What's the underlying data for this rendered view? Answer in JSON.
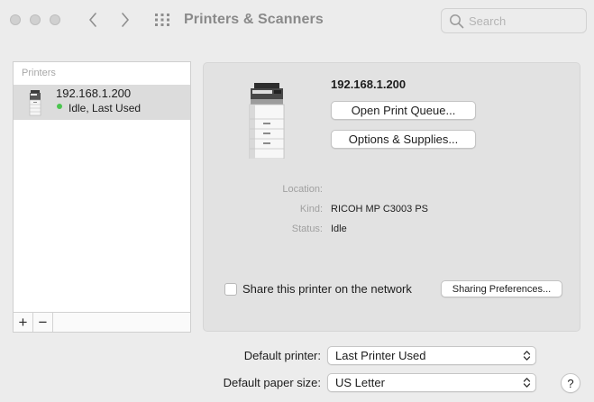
{
  "window": {
    "title": "Printers & Scanners"
  },
  "toolbar": {
    "back_icon": "chevron-left-icon",
    "forward_icon": "chevron-right-icon",
    "show_all_icon": "grid-icon"
  },
  "search": {
    "placeholder": "Search",
    "value": ""
  },
  "printer_list": {
    "header": "Printers",
    "items": [
      {
        "name": "192.168.1.200",
        "status": "Idle, Last Used",
        "status_color": "#4cc550"
      }
    ],
    "add_label": "+",
    "remove_label": "−"
  },
  "details": {
    "printer_name": "192.168.1.200",
    "open_queue_label": "Open Print Queue...",
    "options_label": "Options & Supplies...",
    "location_label": "Location:",
    "location_value": "",
    "kind_label": "Kind:",
    "kind_value": "RICOH MP C3003 PS",
    "status_label": "Status:",
    "status_value": "Idle",
    "share_label": "Share this printer on the network",
    "share_checked": false,
    "sharing_prefs_label": "Sharing Preferences..."
  },
  "defaults": {
    "printer_label": "Default printer:",
    "printer_value": "Last Printer Used",
    "paper_label": "Default paper size:",
    "paper_value": "US Letter"
  },
  "help": {
    "label": "?"
  }
}
